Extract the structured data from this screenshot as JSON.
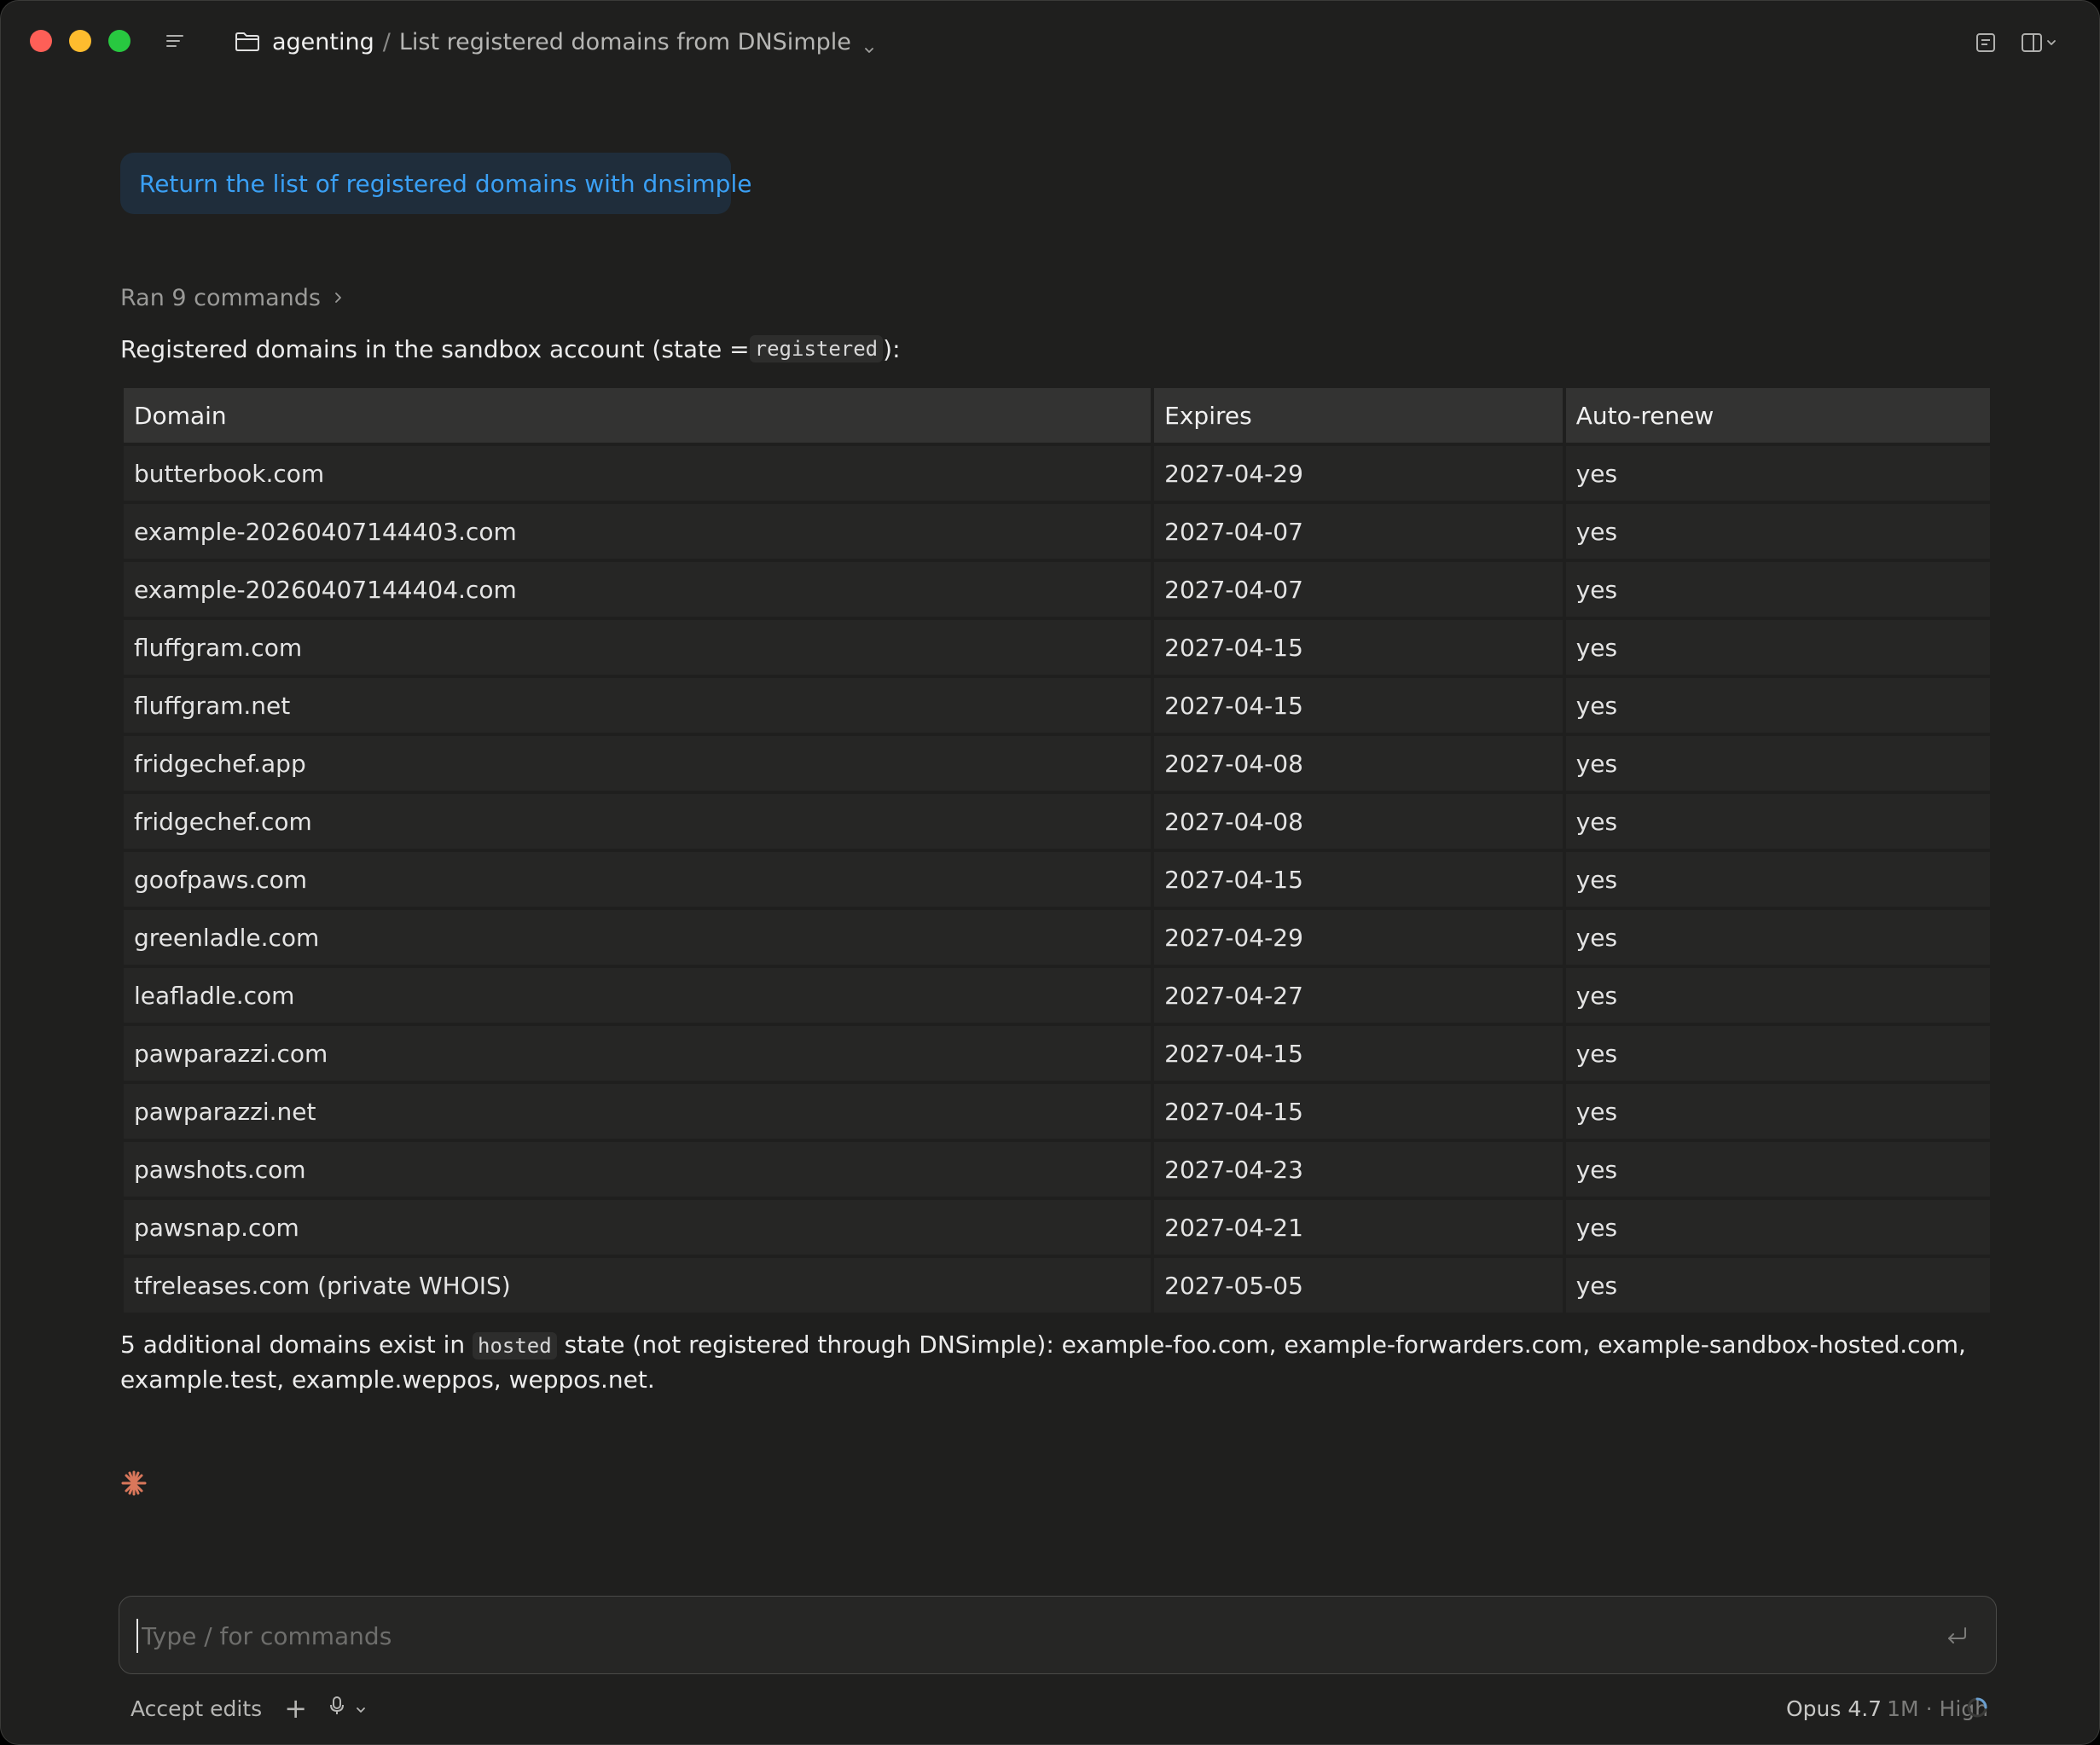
{
  "window": {
    "breadcrumb": {
      "project": "agenting",
      "separator": "/",
      "title": "List registered domains from DNSimple"
    }
  },
  "conversation": {
    "user_message": "Return the list of registered domains with dnsimple",
    "ran_commands": "Ran 9 commands",
    "intro_before": "Registered domains in the sandbox account (state = ",
    "intro_code": "registered",
    "intro_after": "):",
    "table": {
      "headers": [
        "Domain",
        "Expires",
        "Auto-renew"
      ],
      "rows": [
        [
          "butterbook.com",
          "2027-04-29",
          "yes"
        ],
        [
          "example-20260407144403.com",
          "2027-04-07",
          "yes"
        ],
        [
          "example-20260407144404.com",
          "2027-04-07",
          "yes"
        ],
        [
          "fluffgram.com",
          "2027-04-15",
          "yes"
        ],
        [
          "fluffgram.net",
          "2027-04-15",
          "yes"
        ],
        [
          "fridgechef.app",
          "2027-04-08",
          "yes"
        ],
        [
          "fridgechef.com",
          "2027-04-08",
          "yes"
        ],
        [
          "goofpaws.com",
          "2027-04-15",
          "yes"
        ],
        [
          "greenladle.com",
          "2027-04-29",
          "yes"
        ],
        [
          "leafladle.com",
          "2027-04-27",
          "yes"
        ],
        [
          "pawparazzi.com",
          "2027-04-15",
          "yes"
        ],
        [
          "pawparazzi.net",
          "2027-04-15",
          "yes"
        ],
        [
          "pawshots.com",
          "2027-04-23",
          "yes"
        ],
        [
          "pawsnap.com",
          "2027-04-21",
          "yes"
        ],
        [
          "tfreleases.com (private WHOIS)",
          "2027-05-05",
          "yes"
        ]
      ]
    },
    "footer_before": "5 additional domains exist in ",
    "footer_code": "hosted",
    "footer_after": " state (not registered through DNSimple): example-foo.com, example-forwarders.com, example-sandbox-hosted.com, example.test, example.weppos, weppos.net."
  },
  "composer": {
    "value": "",
    "placeholder": "Type / for commands",
    "mode_label": "Accept edits",
    "plus_label": "+",
    "model": "Opus 4.7",
    "context": "1M",
    "separator": "·",
    "effort": "High"
  },
  "icons": {
    "folder": "folder-icon",
    "sidebar_toggle": "sidebar-toggle-icon",
    "notes": "notes-icon",
    "panel": "panel-icon",
    "spark": "spark-icon",
    "enter": "enter-icon",
    "mic": "mic-icon",
    "spinner": "spinner-icon"
  },
  "colors": {
    "background": "#1f1f1e",
    "user_bubble_bg": "#1f2d3b",
    "user_bubble_text": "#3aa0f5",
    "spark": "#d9775b",
    "traffic_red": "#fe5f57",
    "traffic_yellow": "#febc2e",
    "traffic_green": "#28c840"
  }
}
